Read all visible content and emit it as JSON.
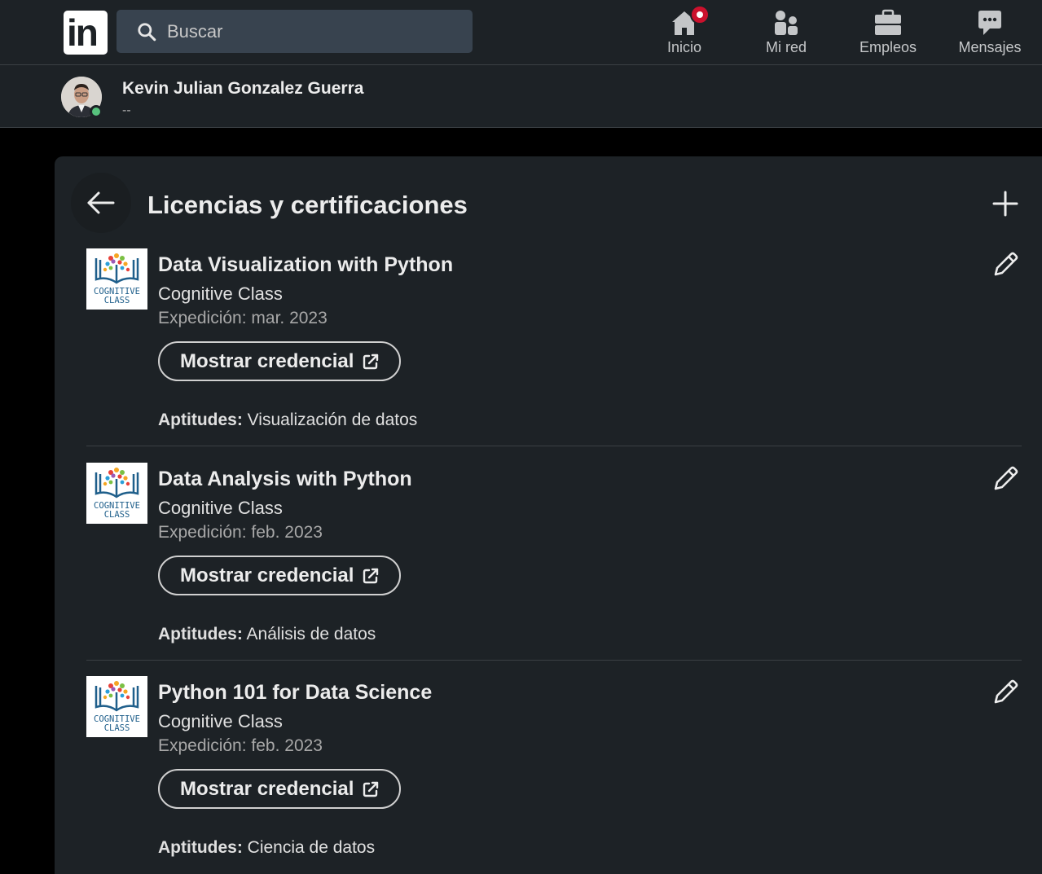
{
  "nav": {
    "search_placeholder": "Buscar",
    "items": [
      {
        "label": "Inicio",
        "icon": "home-icon"
      },
      {
        "label": "Mi red",
        "icon": "network-icon"
      },
      {
        "label": "Empleos",
        "icon": "briefcase-icon"
      },
      {
        "label": "Mensajes",
        "icon": "messages-icon"
      }
    ]
  },
  "profile": {
    "name": "Kevin Julian Gonzalez Guerra",
    "subtitle": "--"
  },
  "section": {
    "title": "Licencias y certificaciones"
  },
  "certifications": [
    {
      "title": "Data Visualization with Python",
      "org": "Cognitive Class",
      "issued": "Expedición: mar. 2023",
      "button": "Mostrar credencial",
      "skills_label": "Aptitudes:",
      "skills": "Visualización de datos",
      "logo_text": [
        "COGNITIVE",
        "CLASS"
      ]
    },
    {
      "title": "Data Analysis with Python",
      "org": "Cognitive Class",
      "issued": "Expedición: feb. 2023",
      "button": "Mostrar credencial",
      "skills_label": "Aptitudes:",
      "skills": "Análisis de datos",
      "logo_text": [
        "COGNITIVE",
        "CLASS"
      ]
    },
    {
      "title": "Python 101 for Data Science",
      "org": "Cognitive Class",
      "issued": "Expedición: feb. 2023",
      "button": "Mostrar credencial",
      "skills_label": "Aptitudes:",
      "skills": "Ciencia de datos",
      "logo_text": [
        "COGNITIVE",
        "CLASS"
      ]
    }
  ],
  "colors": {
    "bg": "#000000",
    "surface": "#1d2226",
    "search_bg": "#38434f",
    "badge": "#cb112d",
    "online": "#57c27d"
  }
}
